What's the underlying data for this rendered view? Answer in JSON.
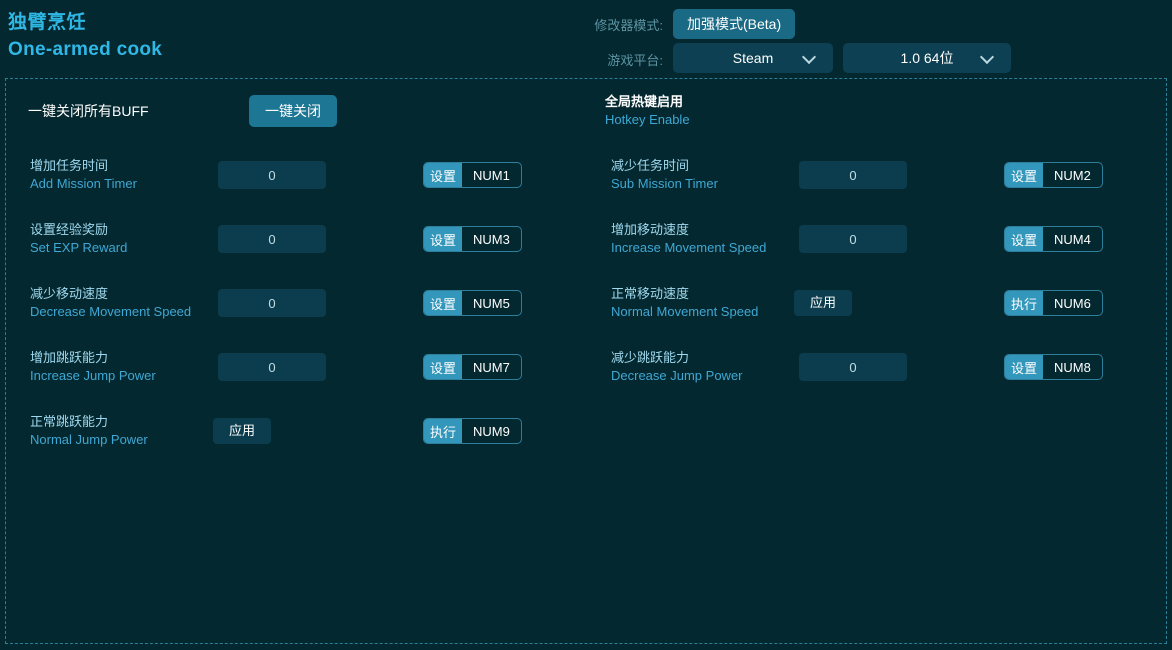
{
  "header": {
    "title_cn": "独臂烹饪",
    "title_en": "One-armed cook",
    "mode_label": "修改器模式:",
    "mode_button": "加强模式(Beta)",
    "platform_label": "游戏平台:",
    "platform_value": "Steam",
    "version_value": "1.0 64位"
  },
  "toprow": {
    "buff_label": "一键关闭所有BUFF",
    "buff_button": "一键关闭",
    "hotkey_cn": "全局热键启用",
    "hotkey_en": "Hotkey Enable",
    "toggle_on": true
  },
  "cheats": [
    {
      "label_cn": "增加任务时间",
      "label_en": "Add Mission Timer",
      "control": "input",
      "value": "0",
      "hotkey_action": "设置",
      "hotkey_key": "NUM1"
    },
    {
      "label_cn": "减少任务时间",
      "label_en": "Sub Mission Timer",
      "control": "input",
      "value": "0",
      "hotkey_action": "设置",
      "hotkey_key": "NUM2"
    },
    {
      "label_cn": "设置经验奖励",
      "label_en": "Set EXP Reward",
      "control": "input",
      "value": "0",
      "hotkey_action": "设置",
      "hotkey_key": "NUM3"
    },
    {
      "label_cn": "增加移动速度",
      "label_en": "Increase Movement Speed",
      "control": "input",
      "value": "0",
      "hotkey_action": "设置",
      "hotkey_key": "NUM4"
    },
    {
      "label_cn": "减少移动速度",
      "label_en": "Decrease Movement Speed",
      "control": "input",
      "value": "0",
      "hotkey_action": "设置",
      "hotkey_key": "NUM5"
    },
    {
      "label_cn": "正常移动速度",
      "label_en": "Normal Movement Speed",
      "control": "button",
      "value": "应用",
      "hotkey_action": "执行",
      "hotkey_key": "NUM6"
    },
    {
      "label_cn": "增加跳跃能力",
      "label_en": "Increase Jump Power",
      "control": "input",
      "value": "0",
      "hotkey_action": "设置",
      "hotkey_key": "NUM7"
    },
    {
      "label_cn": "减少跳跃能力",
      "label_en": "Decrease Jump Power",
      "control": "input",
      "value": "0",
      "hotkey_action": "设置",
      "hotkey_key": "NUM8"
    },
    {
      "label_cn": "正常跳跃能力",
      "label_en": "Normal Jump Power",
      "control": "button",
      "value": "应用",
      "hotkey_action": "执行",
      "hotkey_key": "NUM9"
    }
  ],
  "colors": {
    "background": "#04282f",
    "accent": "#2fb8e6",
    "label_en": "#3fa8d4",
    "toggle_on": "#2fb541",
    "hotkey_action": "#3397bb",
    "panel_border": "#2b7f96"
  }
}
